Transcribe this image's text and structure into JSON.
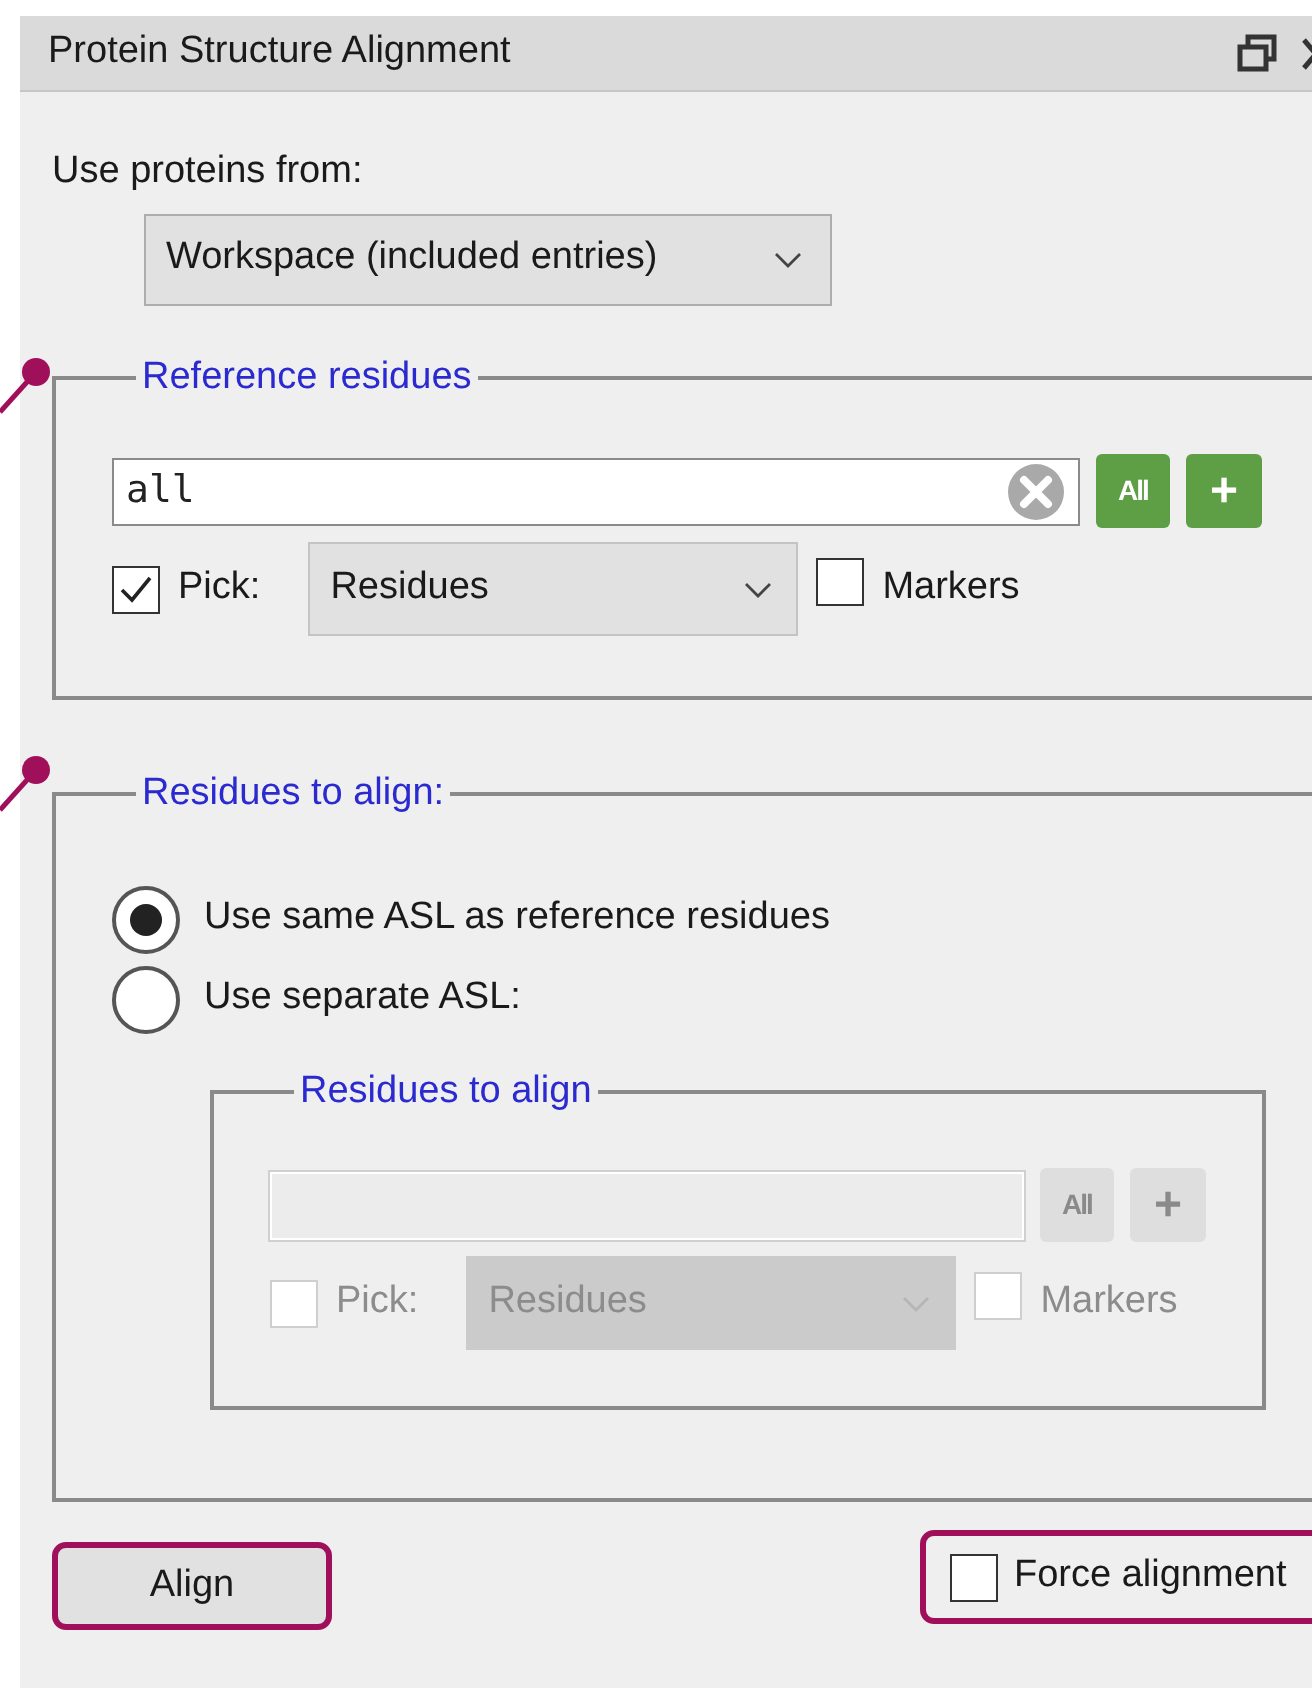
{
  "window": {
    "title": "Protein Structure Alignment"
  },
  "source": {
    "label": "Use proteins from:",
    "value": "Workspace (included entries)"
  },
  "reference_group": {
    "title": "Reference residues",
    "callout": true,
    "disabled": false,
    "field": {
      "value": "all"
    },
    "all_button": "All",
    "add_button": "+",
    "pick": {
      "label": "Pick:",
      "checked": true
    },
    "pick_type": "Residues",
    "markers": {
      "label": "Markers",
      "checked": false
    }
  },
  "align_group": {
    "title": "Residues to align:",
    "callout": true,
    "options": [
      {
        "label": "Use same ASL as reference residues",
        "selected": true
      },
      {
        "label": "Use separate ASL:",
        "selected": false
      }
    ],
    "inner_group": {
      "title": "Residues to align",
      "disabled": true,
      "all_button": "All",
      "add_button": "+",
      "pick": {
        "label": "Pick:",
        "checked": false
      },
      "pick_type": "Residues",
      "markers": {
        "label": "Markers",
        "checked": false
      }
    }
  },
  "align_button": {
    "label": "Align",
    "highlighted": true
  },
  "force_alignment": {
    "label": "Force alignment",
    "checked": false,
    "highlighted": true
  }
}
